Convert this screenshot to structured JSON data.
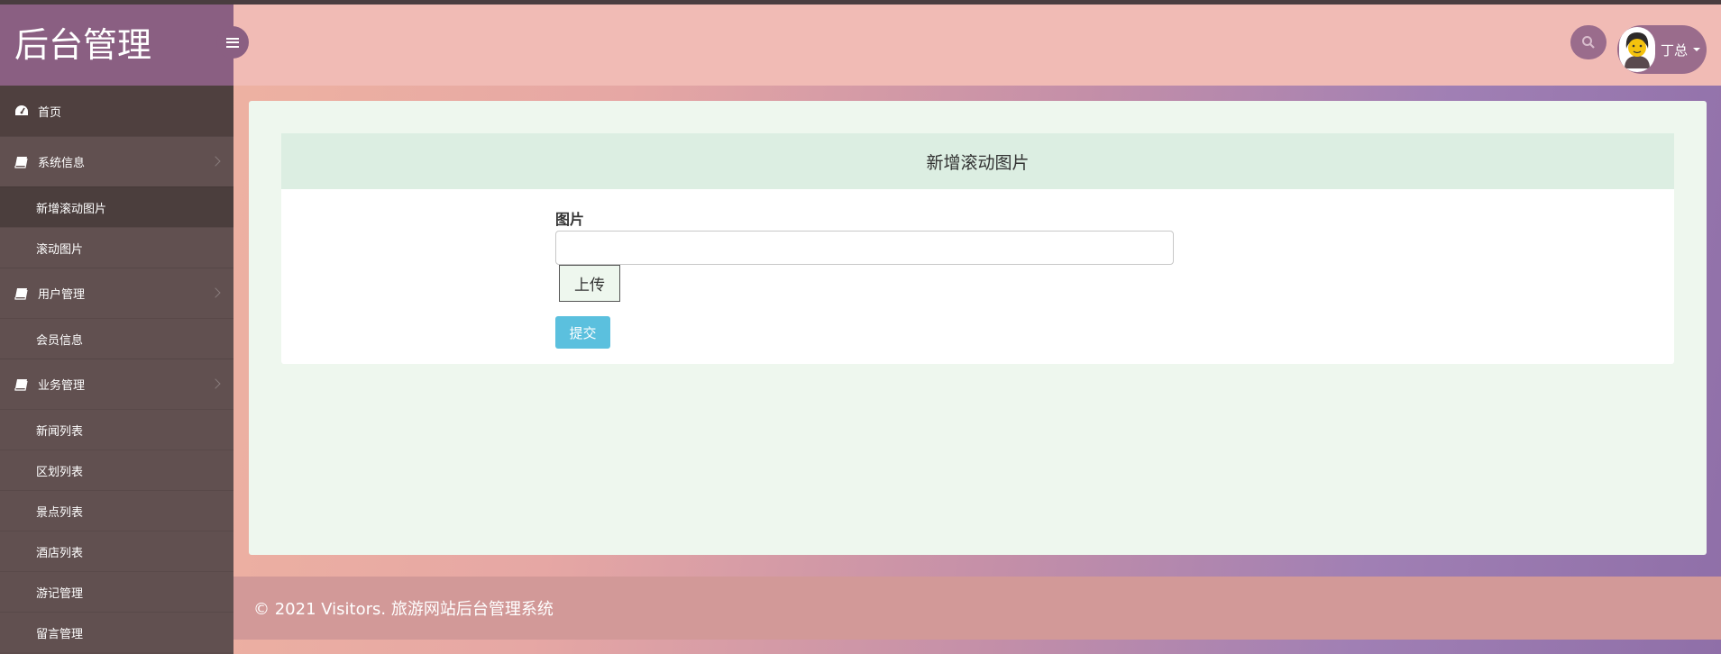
{
  "sidebar": {
    "brand": "后台管理",
    "home": "首页",
    "groups": [
      {
        "label": "系统信息",
        "items": [
          "新增滚动图片",
          "滚动图片"
        ]
      },
      {
        "label": "用户管理",
        "items": [
          "会员信息"
        ]
      },
      {
        "label": "业务管理",
        "items": [
          "新闻列表",
          "区划列表",
          "景点列表",
          "酒店列表",
          "游记管理",
          "留言管理"
        ]
      }
    ]
  },
  "header": {
    "user_name": "丁总"
  },
  "form": {
    "title": "新增滚动图片",
    "field_label": "图片",
    "field_value": "",
    "upload_label": "上传",
    "submit_label": "提交"
  },
  "footer": {
    "text": "© 2021 Visitors. 旅游网站后台管理系统"
  },
  "colors": {
    "brand": "#8a5f82",
    "header": "#f1bbb5",
    "submit": "#5bc0de"
  }
}
